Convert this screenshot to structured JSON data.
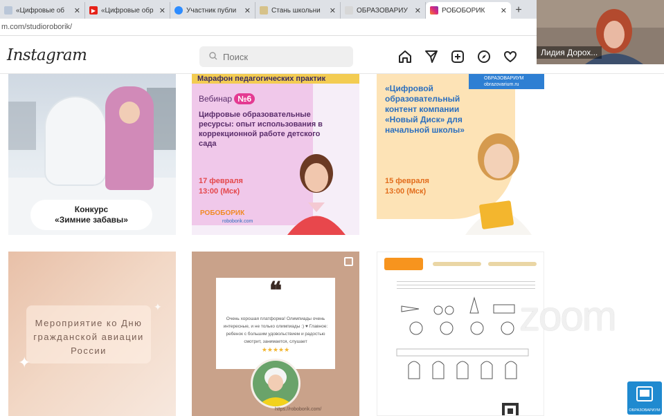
{
  "browser": {
    "tabs": [
      {
        "title": "«Цифровые об",
        "icon": "page-icon",
        "color": "#b9c6d8"
      },
      {
        "title": "«Цифровые обр",
        "icon": "youtube-icon",
        "color": "#e62117"
      },
      {
        "title": "Участник публи",
        "icon": "zoom-icon",
        "color": "#2d8cff"
      },
      {
        "title": "Стань школьни",
        "icon": "page-icon",
        "color": "#d6c28a"
      },
      {
        "title": "ОБРАЗОВАРИУ",
        "icon": "page-icon",
        "color": "#d7d7d7"
      },
      {
        "title": "РОБОБОРИК",
        "icon": "instagram-icon",
        "color": "#d6249f"
      }
    ],
    "active_tab_index": 5,
    "address": "m.com/studioroborik/"
  },
  "instagram": {
    "logo": "Instagram",
    "search_placeholder": "Поиск"
  },
  "video": {
    "participant_name": "Лидия Дорох..."
  },
  "posts": {
    "p1": {
      "caption_line1": "Конкурс",
      "caption_line2": "«Зимние забавы»"
    },
    "p2": {
      "header": "Марафон педагогических практик",
      "webinar": "Вебинар",
      "number": "№6",
      "title": "Цифровые образовательные ресурсы: опыт использования в коррекционной работе детского сада",
      "date": "17 февраля",
      "time": "13:00 (Мск)",
      "brand": "РОБОБОРИК",
      "site": "roboborik.com"
    },
    "p3": {
      "tag_line1": "ОБРАЗОВАРИУМ",
      "tag_line2": "obrazovarium.ru",
      "title": "«Цифровой образовательный контент компании «Новый Диск» для начальной школы»",
      "date": "15 февраля",
      "time": "13:00 (Мск)"
    },
    "p4": {
      "title": "Мероприятие ко Дню гражданской авиации России"
    },
    "p5": {
      "quote_mark": "❝",
      "review": "Очень хорошая платформа! Олимпиады очень интересные, и не только олимпиады :) ♥ Главное: ребенок с большим удовольствием и радостью смотрит, занимается, слушает",
      "stars": "★★★★★",
      "site": "https://roboborik.com/"
    }
  },
  "overlay": {
    "zoom_watermark": "zoom",
    "badge_label": "ОБРАЗОВАРИУМ"
  }
}
